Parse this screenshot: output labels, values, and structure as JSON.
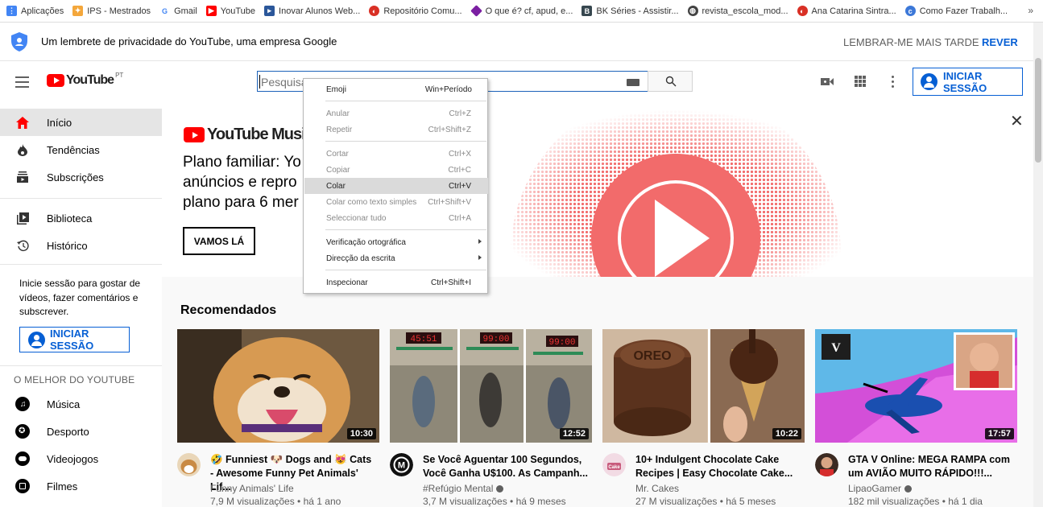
{
  "bookmarks": {
    "items": [
      {
        "label": "Aplicações",
        "icon": "apps-grid-icon",
        "color": "#4285f4"
      },
      {
        "label": "IPS - Mestrados",
        "icon": "ips-icon",
        "color": "#f4a73b"
      },
      {
        "label": "Gmail",
        "icon": "google-icon",
        "color": "#4285f4"
      },
      {
        "label": "YouTube",
        "icon": "youtube-icon",
        "color": "#ff0000"
      },
      {
        "label": "Inovar Alunos Web...",
        "icon": "inovar-icon",
        "color": "#2b579a"
      },
      {
        "label": "Repositório Comu...",
        "icon": "repository-icon",
        "color": "#d93025"
      },
      {
        "label": "O que é? cf, apud, e...",
        "icon": "diamond-icon",
        "color": "#7b1fa2"
      },
      {
        "label": "BK Séries - Assistir...",
        "icon": "bk-icon",
        "color": "#37474f"
      },
      {
        "label": "revista_escola_mod...",
        "icon": "globe-icon",
        "color": "#424242"
      },
      {
        "label": "Ana Catarina Sintra...",
        "icon": "repository-icon",
        "color": "#d93025"
      },
      {
        "label": "Como Fazer Trabalh...",
        "icon": "blog-icon",
        "color": "#3c78d8"
      }
    ],
    "more": "»"
  },
  "banner": {
    "text": "Um lembrete de privacidade do YouTube, uma empresa Google",
    "later": "LEMBRAR-ME MAIS TARDE",
    "review": "REVER"
  },
  "masthead": {
    "logo_text": "YouTube",
    "region": "PT",
    "search_placeholder": "Pesquisar",
    "signin": "INICIAR SESSÃO"
  },
  "sidebar": {
    "main": [
      {
        "label": "Início",
        "icon": "home-icon",
        "active": true
      },
      {
        "label": "Tendências",
        "icon": "flame-icon",
        "active": false
      },
      {
        "label": "Subscrições",
        "icon": "subscriptions-icon",
        "active": false
      }
    ],
    "library": [
      {
        "label": "Biblioteca",
        "icon": "library-icon"
      },
      {
        "label": "Histórico",
        "icon": "history-icon"
      }
    ],
    "signin_text": "Inicie sessão para gostar de vídeos, fazer comentários e subscrever.",
    "signin_button": "INICIAR SESSÃO",
    "best_title": "O MELHOR DO YOUTUBE",
    "best": [
      {
        "label": "Música",
        "icon": "music-icon"
      },
      {
        "label": "Desporto",
        "icon": "sport-icon"
      },
      {
        "label": "Videojogos",
        "icon": "gaming-icon"
      },
      {
        "label": "Filmes",
        "icon": "film-icon"
      }
    ]
  },
  "promo": {
    "logo_text": "YouTube Music",
    "text": "Plano familiar: Yo\nanúncios e repro\nplano para 6 mer",
    "button": "VAMOS LÁ",
    "close": "✕",
    "accent": "#f26b6b"
  },
  "recommended": {
    "title": "Recomendados",
    "videos": [
      {
        "title": "🤣 Funniest 🐶 Dogs and 😻 Cats - Awesome Funny Pet Animals' Lif...",
        "channel": "Funny Animals' Life",
        "verified": false,
        "stats": "7,9 M visualizações • há 1 ano",
        "duration": "10:30"
      },
      {
        "title": "Se Você Aguentar 100 Segundos, Você Ganha U$100. As Campanh...",
        "channel": "#Refúgio Mental",
        "verified": true,
        "stats": "3,7 M visualizações • há 9 meses",
        "duration": "12:52"
      },
      {
        "title": "10+ Indulgent Chocolate Cake Recipes | Easy Chocolate Cake...",
        "channel": "Mr. Cakes",
        "verified": false,
        "stats": "27 M visualizações • há 5 meses",
        "duration": "10:22"
      },
      {
        "title": "GTA V Online: MEGA RAMPA com um AVIÃO MUITO RÁPIDO!!!...",
        "channel": "LipaoGamer",
        "verified": true,
        "stats": "182 mil visualizações • há 1 dia",
        "duration": "17:57"
      }
    ]
  },
  "context_menu": {
    "items": [
      {
        "label": "Emoji",
        "shortcut": "Win+Período",
        "enabled": true
      },
      {
        "label": "Anular",
        "shortcut": "Ctrl+Z",
        "enabled": false
      },
      {
        "label": "Repetir",
        "shortcut": "Ctrl+Shift+Z",
        "enabled": false
      },
      {
        "label": "Cortar",
        "shortcut": "Ctrl+X",
        "enabled": false
      },
      {
        "label": "Copiar",
        "shortcut": "Ctrl+C",
        "enabled": false
      },
      {
        "label": "Colar",
        "shortcut": "Ctrl+V",
        "enabled": true,
        "highlighted": true
      },
      {
        "label": "Colar como texto simples",
        "shortcut": "Ctrl+Shift+V",
        "enabled": false
      },
      {
        "label": "Seleccionar tudo",
        "shortcut": "Ctrl+A",
        "enabled": false
      },
      {
        "label": "Verificação ortográfica",
        "shortcut": "",
        "enabled": true,
        "submenu": true
      },
      {
        "label": "Direcção da escrita",
        "shortcut": "",
        "enabled": true,
        "submenu": true
      },
      {
        "label": "Inspecionar",
        "shortcut": "Ctrl+Shift+I",
        "enabled": true
      }
    ]
  }
}
